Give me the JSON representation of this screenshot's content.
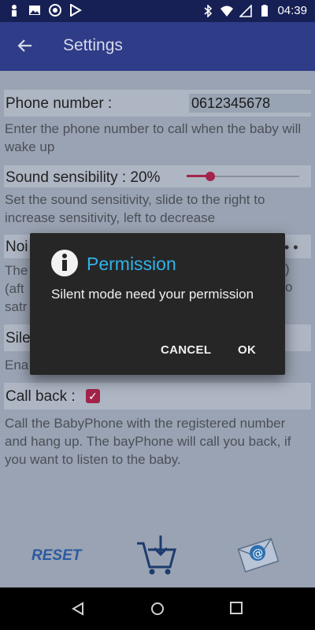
{
  "statusbar": {
    "time": "04:39",
    "left_icons": [
      "person-icon",
      "image-icon",
      "globe-icon",
      "play-store-icon"
    ],
    "right_icons": [
      "bluetooth-icon",
      "wifi-icon",
      "signal-icon",
      "battery-icon"
    ]
  },
  "appbar": {
    "title": "Settings"
  },
  "settings": {
    "phone_label": "Phone number :",
    "phone_value": "0612345678",
    "phone_desc": "Enter the phone number to call when the baby will wake up",
    "sound_label": "Sound sensibility : 20%",
    "sound_level": 0.2,
    "sound_desc": "Set the sound sensitivity, slide to the right to increase sensitivity, left to decrease",
    "noise_label_partial": "Noi",
    "noise_desc_partial": "The",
    "noise_desc_partial2": "(aft",
    "noise_desc_partial3": "satr",
    "noise_desc_right": ")",
    "noise_desc_right2": "o",
    "silent_label_partial": "Sile",
    "silent_desc_partial": "Ena",
    "callback_label": "Call back :",
    "callback_checked": true,
    "callback_desc": "Call the BabyPhone with the registered number and hang up. The bayPhone will call you back, if you want to listen to the baby."
  },
  "actions": {
    "reset_label": "RESET"
  },
  "dialog": {
    "title": "Permission",
    "message": "Silent mode need your permission",
    "cancel_label": "CANCEL",
    "ok_label": "OK"
  },
  "colors": {
    "accent": "#a3244a",
    "appbar": "#2f3c88",
    "dialog_title": "#32b2e8"
  }
}
